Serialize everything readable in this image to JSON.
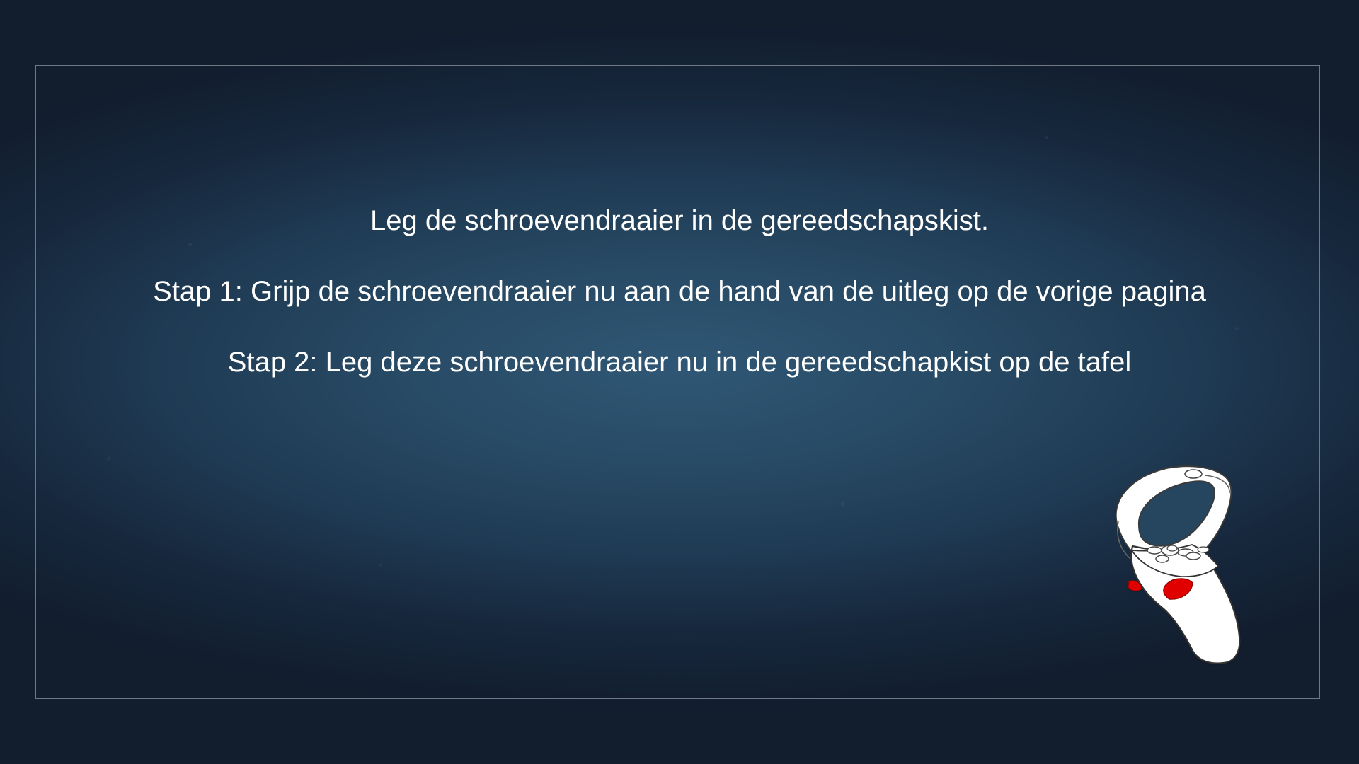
{
  "instructions": {
    "heading": "Leg de schroevendraaier in de gereedschapskist.",
    "step1": "Stap 1: Grijp de schroevendraaier nu aan de hand van de uitleg op de vorige pagina",
    "step2": "Stap 2: Leg deze schroevendraaier nu in de gereedschapkist op de tafel"
  },
  "illustration": {
    "icon": "vr-controller-icon",
    "highlight_color": "#e10600"
  }
}
